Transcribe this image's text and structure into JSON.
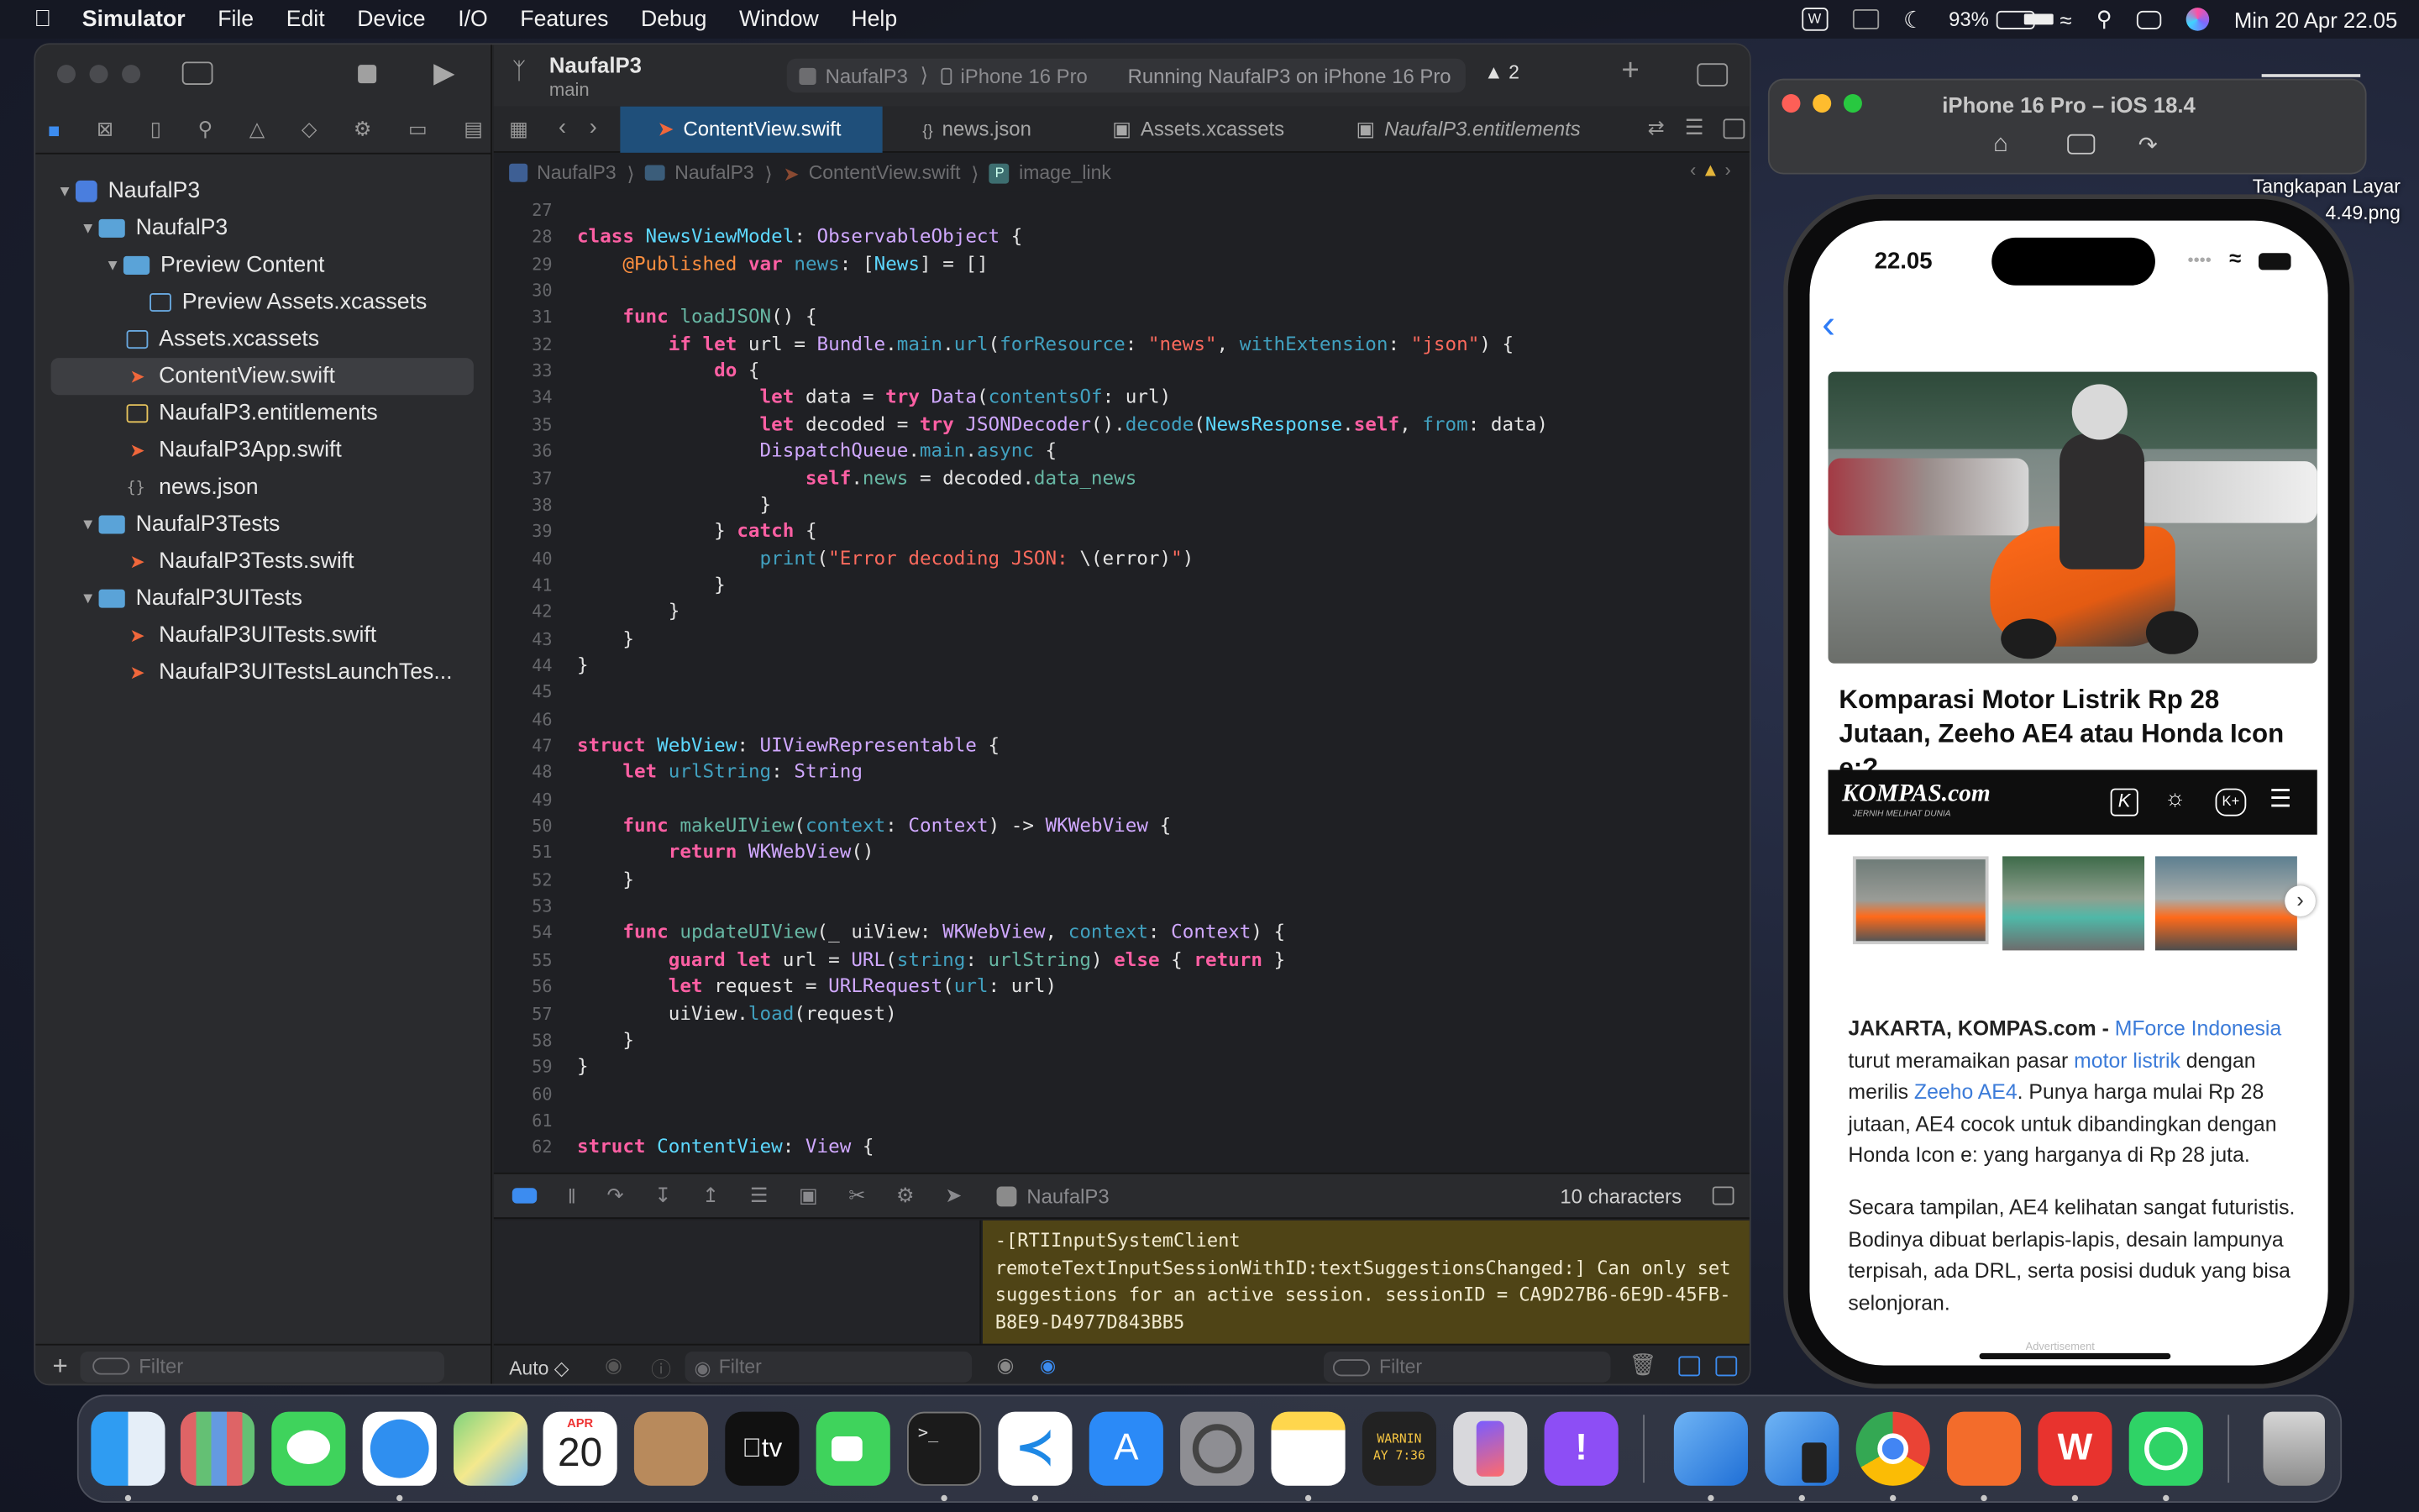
{
  "menubar": {
    "app": "Simulator",
    "items": [
      "File",
      "Edit",
      "Device",
      "I/O",
      "Features",
      "Debug",
      "Window",
      "Help"
    ],
    "battery": "93%",
    "datetime": "Min 20 Apr  22.05"
  },
  "xcode": {
    "project": "NaufalP3",
    "branch": "main",
    "scheme": "NaufalP3",
    "device": "iPhone 16 Pro",
    "status": "Running NaufalP3 on iPhone 16 Pro",
    "warnings": "2",
    "navigator": [
      {
        "label": "NaufalP3",
        "type": "project"
      },
      {
        "label": "NaufalP3",
        "type": "folder"
      },
      {
        "label": "Preview Content",
        "type": "folder"
      },
      {
        "label": "Preview Assets.xcassets",
        "type": "asset"
      },
      {
        "label": "Assets.xcassets",
        "type": "asset"
      },
      {
        "label": "ContentView.swift",
        "type": "swift"
      },
      {
        "label": "NaufalP3.entitlements",
        "type": "entitlements"
      },
      {
        "label": "NaufalP3App.swift",
        "type": "swift"
      },
      {
        "label": "news.json",
        "type": "json"
      },
      {
        "label": "NaufalP3Tests",
        "type": "folder"
      },
      {
        "label": "NaufalP3Tests.swift",
        "type": "swift"
      },
      {
        "label": "NaufalP3UITests",
        "type": "folder"
      },
      {
        "label": "NaufalP3UITests.swift",
        "type": "swift"
      },
      {
        "label": "NaufalP3UITestsLaunchTes...",
        "type": "swift"
      }
    ],
    "filter_placeholder": "Filter",
    "tabs": [
      "ContentView.swift",
      "news.json",
      "Assets.xcassets",
      "NaufalP3.entitlements"
    ],
    "breadcrumb": [
      "NaufalP3",
      "NaufalP3",
      "ContentView.swift",
      "image_link"
    ],
    "code_lines": [
      {
        "n": "27",
        "html": ""
      },
      {
        "n": "28",
        "html": "<span class='kw'>class</span> <span class='ty2'>NewsViewModel</span>: <span class='ty'>ObservableObject</span> {"
      },
      {
        "n": "29",
        "html": "    <span class='at'>@Published</span> <span class='kw'>var</span> <span class='pr'>news</span>: [<span class='ty2'>News</span>] = []"
      },
      {
        "n": "30",
        "html": ""
      },
      {
        "n": "31",
        "html": "    <span class='kw'>func</span> <span class='fn'>loadJSON</span>() {"
      },
      {
        "n": "32",
        "html": "        <span class='kw'>if let</span> url = <span class='ty'>Bundle</span>.<span class='pr'>main</span>.<span class='pr'>url</span>(<span class='pr'>forResource</span>: <span class='st'>\"news\"</span>, <span class='pr'>withExtension</span>: <span class='st'>\"json\"</span>) {"
      },
      {
        "n": "33",
        "html": "            <span class='kw'>do</span> {"
      },
      {
        "n": "34",
        "html": "                <span class='kw'>let</span> data = <span class='kw'>try</span> <span class='ty'>Data</span>(<span class='pr'>contentsOf</span>: url)"
      },
      {
        "n": "35",
        "html": "                <span class='kw'>let</span> decoded = <span class='kw'>try</span> <span class='ty'>JSONDecoder</span>().<span class='pr'>decode</span>(<span class='ty2'>NewsResponse</span>.<span class='kw'>self</span>, <span class='pr'>from</span>: data)"
      },
      {
        "n": "36",
        "html": "                <span class='ty'>DispatchQueue</span>.<span class='pr'>main</span>.<span class='pr'>async</span> {"
      },
      {
        "n": "37",
        "html": "                    <span class='kw'>self</span>.<span class='fn'>news</span> = decoded.<span class='fn'>data_news</span>"
      },
      {
        "n": "38",
        "html": "                }"
      },
      {
        "n": "39",
        "html": "            } <span class='kw'>catch</span> {"
      },
      {
        "n": "40",
        "html": "                <span class='pr'>print</span>(<span class='st'>\"Error decoding JSON: </span>\\(error)<span class='st'>\"</span>)"
      },
      {
        "n": "41",
        "html": "            }"
      },
      {
        "n": "42",
        "html": "        }"
      },
      {
        "n": "43",
        "html": "    }"
      },
      {
        "n": "44",
        "html": "}"
      },
      {
        "n": "45",
        "html": ""
      },
      {
        "n": "46",
        "html": ""
      },
      {
        "n": "47",
        "html": "<span class='kw'>struct</span> <span class='ty2'>WebView</span>: <span class='ty'>UIViewRepresentable</span> {"
      },
      {
        "n": "48",
        "html": "    <span class='kw'>let</span> <span class='pr'>urlString</span>: <span class='ty'>String</span>"
      },
      {
        "n": "49",
        "html": ""
      },
      {
        "n": "50",
        "html": "    <span class='kw'>func</span> <span class='fn'>makeUIView</span>(<span class='pr'>context</span>: <span class='ty'>Context</span>) -> <span class='ty'>WKWebView</span> {"
      },
      {
        "n": "51",
        "html": "        <span class='kw'>return</span> <span class='ty'>WKWebView</span>()"
      },
      {
        "n": "52",
        "html": "    }"
      },
      {
        "n": "53",
        "html": ""
      },
      {
        "n": "54",
        "html": "    <span class='kw'>func</span> <span class='fn'>updateUIView</span>(_ uiView: <span class='ty'>WKWebView</span>, <span class='pr'>context</span>: <span class='ty'>Context</span>) {"
      },
      {
        "n": "55",
        "html": "        <span class='kw'>guard let</span> url = <span class='ty'>URL</span>(<span class='pr'>string</span>: <span class='fn'>urlString</span>) <span class='kw'>else</span> { <span class='kw'>return</span> }"
      },
      {
        "n": "56",
        "html": "        <span class='kw'>let</span> request = <span class='ty'>URLRequest</span>(<span class='pr'>url</span>: url)"
      },
      {
        "n": "57",
        "html": "        uiView.<span class='pr'>load</span>(request)"
      },
      {
        "n": "58",
        "html": "    }"
      },
      {
        "n": "59",
        "html": "}"
      },
      {
        "n": "60",
        "html": ""
      },
      {
        "n": "61",
        "html": ""
      },
      {
        "n": "62",
        "html": "<span class='kw'>struct</span> <span class='ty2'>ContentView</span>: <span class='ty'>View</span> {"
      }
    ],
    "debug_target": "NaufalP3",
    "char_count": "10 characters",
    "console_text": "-[RTIInputSystemClient remoteTextInputSessionWithID:textSuggestionsChanged:]  Can only set suggestions for an active session. sessionID = CA9D27B6-6E9D-45FB-B8E9-D4977D843BB5",
    "auto_label": "Auto ◇",
    "filter1": "Filter",
    "filter2": "Filter"
  },
  "simulator": {
    "title": "iPhone 16 Pro – iOS 18.4",
    "desktop_label_1": "Tangkapan Layar",
    "desktop_label_2": "4.49.png"
  },
  "iphone": {
    "time": "22.05",
    "headline": "Komparasi Motor Listrik Rp 28 Jutaan, Zeeho AE4 atau Honda Icon e:?",
    "kompas_logo": "KOMPAS.com",
    "kompas_tagline": "JERNIH MELIHAT DUNIA",
    "p1_lead": "JAKARTA, KOMPAS.com - ",
    "p1_link1": "MForce Indonesia",
    "p1_text1": " turut meramaikan pasar ",
    "p1_link2": "motor listrik",
    "p1_text2": " dengan merilis ",
    "p1_link3": "Zeeho AE4",
    "p1_text3": ". Punya harga mulai Rp 28 jutaan, AE4 cocok untuk dibandingkan dengan Honda Icon e: yang harganya di Rp 28 juta.",
    "p2": "Secara tampilan, AE4 kelihatan sangat futuristis. Bodinya dibuat berlapis-lapis, desain lampunya terpisah, ada DRL, serta posisi duduk yang bisa selonjoran.",
    "ad_label": "Advertisement"
  },
  "dock": {
    "calendar_month": "APR",
    "calendar_day": "20",
    "console_warn": "WARNIN",
    "console_time": "AY 7:36",
    "apps": [
      "Finder",
      "Launchpad",
      "Messages",
      "Safari",
      "Maps",
      "Calendar",
      "Contacts",
      "TV",
      "FaceTime",
      "Terminal",
      "VS Code",
      "App Store",
      "System Settings",
      "Notes",
      "Console",
      "iPhone Mirroring",
      "Feedback",
      "Xcode",
      "Simulator",
      "Chrome",
      "Pages",
      "WPS",
      "WhatsApp",
      "Trash"
    ]
  },
  "colors": {
    "accent": "#1f4f7a",
    "console_bg": "#4f4416",
    "link": "#3b7bd9"
  }
}
